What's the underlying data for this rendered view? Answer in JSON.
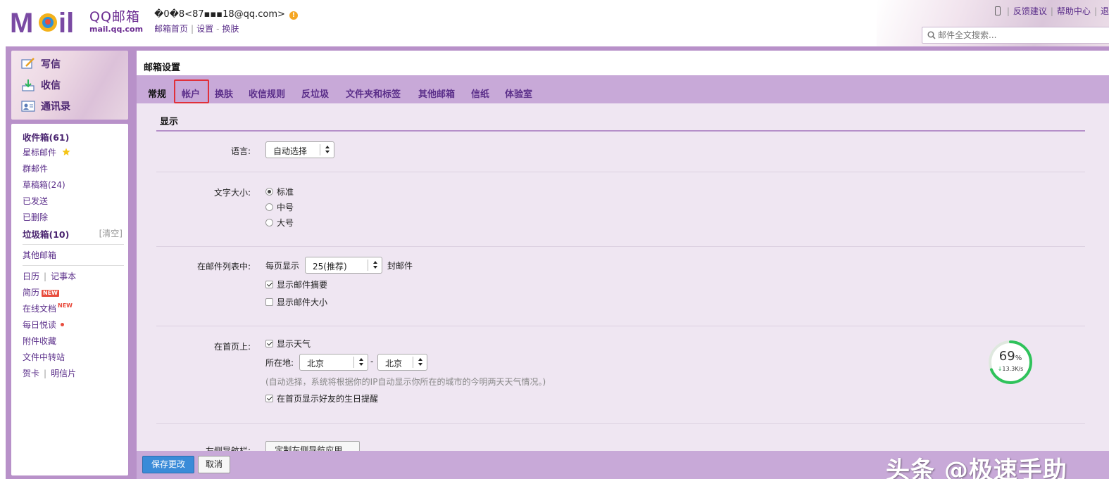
{
  "header": {
    "logo_brand": "QQ邮箱",
    "logo_domain": "mail.qq.com",
    "user_display": "�0�8<87▪▪▪18@qq.com>",
    "links": [
      "邮箱首页",
      "设置",
      "换肤"
    ],
    "top_right": {
      "feedback": "反馈建议",
      "help": "帮助中心",
      "exit": "退"
    },
    "search_placeholder": "邮件全文搜索..."
  },
  "sidebar": {
    "quick_actions": [
      {
        "label": "写信",
        "icon": "compose-icon"
      },
      {
        "label": "收信",
        "icon": "inbox-download-icon"
      },
      {
        "label": "通讯录",
        "icon": "contacts-icon"
      }
    ],
    "folders": {
      "inbox": "收件箱(61)",
      "starred": "星标邮件",
      "group": "群邮件",
      "drafts": "草稿箱(24)",
      "sent": "已发送",
      "deleted": "已删除",
      "spam": "垃圾箱(10)",
      "spam_clear": "[清空]",
      "other_mail": "其他邮箱",
      "calendar": "日历",
      "notepad": "记事本",
      "resume": "简历",
      "resume_badge": "NEW",
      "online_docs": "在线文档",
      "online_docs_badge": "NEW",
      "daily_read": "每日悦读",
      "attachments": "附件收藏",
      "transfer": "文件中转站",
      "greeting_card": "贺卡",
      "postcard": "明信片"
    }
  },
  "main": {
    "title": "邮箱设置",
    "tabs": [
      "常规",
      "帐户",
      "换肤",
      "收信规则",
      "反垃圾",
      "文件夹和标签",
      "其他邮箱",
      "信纸",
      "体验室"
    ],
    "active_tab": "常规",
    "highlighted_tab": "帐户",
    "section_title": "显示",
    "language": {
      "label": "语言:",
      "value": "自动选择"
    },
    "font_size": {
      "label": "文字大小:",
      "options": [
        "标准",
        "中号",
        "大号"
      ],
      "selected": "标准"
    },
    "mail_list": {
      "label": "在邮件列表中:",
      "per_page_prefix": "每页显示",
      "per_page_value": "25(推荐)",
      "per_page_suffix": "封邮件",
      "show_summary": "显示邮件摘要",
      "show_summary_checked": true,
      "show_size": "显示邮件大小",
      "show_size_checked": false
    },
    "homepage": {
      "label": "在首页上:",
      "show_weather": "显示天气",
      "show_weather_checked": true,
      "location_label": "所在地:",
      "province": "北京",
      "dash": "-",
      "city": "北京",
      "hint": "(自动选择，系统将根据你的IP自动显示你所在的城市的今明两天天气情况。)",
      "birthday": "在首页显示好友的生日提醒",
      "birthday_checked": true
    },
    "left_nav": {
      "label": "左侧导航栏:",
      "button": "定制左侧导航应用..."
    },
    "footer": {
      "save": "保存更改",
      "cancel": "取消"
    },
    "watermark": "头条 @极速手助"
  },
  "speed_widget": {
    "percent": "69",
    "percent_unit": "%",
    "rate": "13.3K/s",
    "percent_value": 69
  },
  "colors": {
    "frame": "#b891c9",
    "tabbar": "#c8a9d8",
    "content_bg": "#efe6f2",
    "link": "#5b2f8a",
    "highlight": "#e0303a",
    "save_button": "#3a8bd8"
  }
}
